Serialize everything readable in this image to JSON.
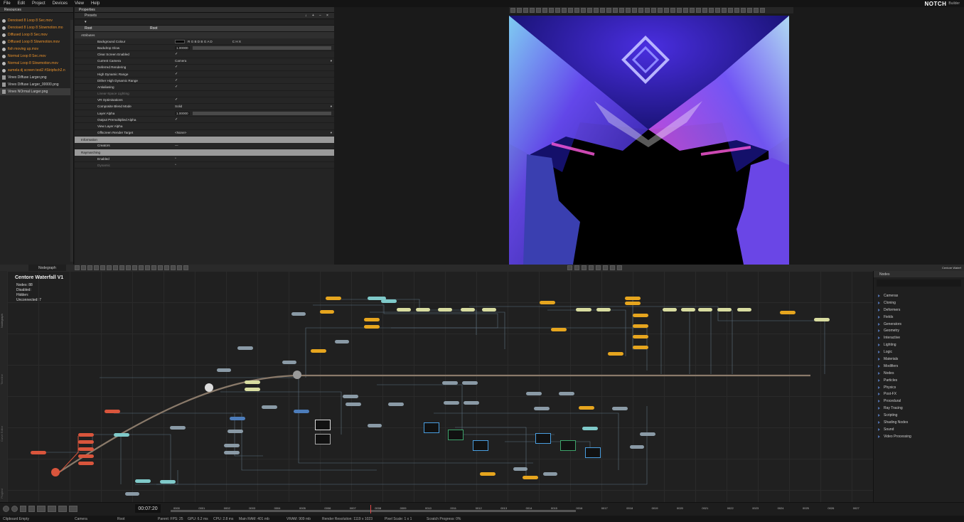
{
  "menu": [
    "File",
    "Edit",
    "Project",
    "Devices",
    "View",
    "Help"
  ],
  "brand": {
    "name": "NOTCH",
    "edition": "Builder"
  },
  "resources": {
    "tab": "Resources",
    "items": [
      {
        "label": "Denoised 8 Loop 8 Sec.mov",
        "color": "orange",
        "kind": "dot"
      },
      {
        "label": "Denoised 8 Loop 8 Slowmotion.mo",
        "color": "orange",
        "kind": "dot"
      },
      {
        "label": "Diffused Loop 8 Sec.mov",
        "color": "orange",
        "kind": "dot"
      },
      {
        "label": "Diffused Loop 8 Slowmotion.mov",
        "color": "orange",
        "kind": "dot"
      },
      {
        "label": "fish moving up.mov",
        "color": "orange",
        "kind": "dot"
      },
      {
        "label": "Normal Loop 8 Sec.mov",
        "color": "orange",
        "kind": "dot"
      },
      {
        "label": "Normal Loop 8 Slowmotion.mov",
        "color": "orange",
        "kind": "dot"
      },
      {
        "label": "sumela dj screen test2 #Stripfsch2.n",
        "color": "orange",
        "kind": "dot"
      },
      {
        "label": "Vinex Diffuse Larger.png",
        "color": "white",
        "kind": "file"
      },
      {
        "label": "Vinex Diffuse Larger_00000.png",
        "color": "white",
        "kind": "file"
      },
      {
        "label": "Vinex NOrmal Larger.png",
        "color": "white",
        "kind": "file",
        "selected": true
      }
    ]
  },
  "properties": {
    "tab": "Properties",
    "presets": "Presets",
    "root_label": "Root",
    "root_value": "Root",
    "sections": {
      "attributes": "Attributes",
      "information": "Information",
      "raymarching": "Raymarching"
    },
    "rows": [
      {
        "label": "Background Colour",
        "value": "R G B D B G A D",
        "extra": "C  H  X",
        "type": "colour"
      },
      {
        "label": "Backdrop Glow",
        "value": "1.00000",
        "type": "slider"
      },
      {
        "label": "Clear Screen Enabled",
        "value": "✓",
        "type": "check"
      },
      {
        "label": "Current Camera",
        "value": "Camera",
        "type": "select"
      },
      {
        "label": "Deferred Rendering",
        "value": "✓",
        "type": "check"
      },
      {
        "label": "High Dynamic Range",
        "value": "✓",
        "type": "check"
      },
      {
        "label": "Dither High Dynamic Range",
        "value": "✓",
        "type": "check"
      },
      {
        "label": "Antialiasing",
        "value": "✓",
        "type": "check"
      },
      {
        "label": "Linear-Space Lighting",
        "value": "",
        "type": "check",
        "dim": true
      },
      {
        "label": "VR Optimisations",
        "value": "✓",
        "type": "check"
      },
      {
        "label": "Composite Blend Mode",
        "value": "Solid",
        "type": "select"
      },
      {
        "label": "Layer Alpha",
        "value": "1.00000",
        "type": "slider"
      },
      {
        "label": "Output Premultiplied Alpha",
        "value": "✓",
        "type": "check"
      },
      {
        "label": "View Layer Alpha",
        "value": "",
        "type": "check"
      },
      {
        "label": "Offscreen Render Target",
        "value": "<None>",
        "type": "select"
      }
    ],
    "info_rows": [
      {
        "label": "Creators",
        "value": "—"
      }
    ],
    "ray_rows": [
      {
        "label": "Enabled",
        "value": ""
      },
      {
        "label": "Dynamic",
        "value": ""
      }
    ]
  },
  "nodegraph": {
    "tab": "Nodegraph",
    "title": "Centore  Waterfall  V1",
    "stats": [
      {
        "label": "Nodes:",
        "value": "88"
      },
      {
        "label": "Disabled:",
        "value": ""
      },
      {
        "label": "Hidden:",
        "value": ""
      },
      {
        "label": "Unconnected:",
        "value": "7"
      }
    ],
    "side_labels": [
      "Nodegraph",
      "Timeline",
      "Curve Editor",
      "Pluginst"
    ]
  },
  "nodes_panel": {
    "tab": "Nodes",
    "items": [
      "Cameras",
      "Cloning",
      "Deformers",
      "Fields",
      "Generators",
      "Geometry",
      "Interactive",
      "Lighting",
      "Logic",
      "Materials",
      "Modifiers",
      "Nodes",
      "Particles",
      "Physics",
      "Post-FX",
      "Procedural",
      "Ray Tracing",
      "Scripting",
      "Shading Nodes",
      "Sound",
      "Video Processing"
    ],
    "top_right_label": "Centore Waterf"
  },
  "timeline": {
    "timecode": "00:07:20",
    "ticks": [
      "0000",
      "0001",
      "0002",
      "0003",
      "0004",
      "0005",
      "0006",
      "0007",
      "0008",
      "0009",
      "0010",
      "0011",
      "0012",
      "0013",
      "0014",
      "0015",
      "0016",
      "0017",
      "0018",
      "0019",
      "0020",
      "0021",
      "0022",
      "0023",
      "0024",
      "0025",
      "0026",
      "0027"
    ]
  },
  "status": {
    "clipboard": "Clipboard Empty",
    "camera": "Camera",
    "root": "Root",
    "fps": "Parent: FPS: 25",
    "gpu": "GPU: 6.2 ms",
    "cpu": "CPU: 2.8 ms",
    "ram": "Main RAM: 401 mb",
    "vram": "VRAM: 909 mb",
    "resolution": "Render Resolution: 1119 x 1023",
    "pixel_scale": "Pixel Scale: 1 x 1",
    "scratch": "Scratch Progress: 0%"
  },
  "colors": {
    "accent_orange": "#e8902a",
    "node_yellow": "#e6a51e",
    "node_red": "#d9553c",
    "render_blue": "#5a3cf0"
  }
}
